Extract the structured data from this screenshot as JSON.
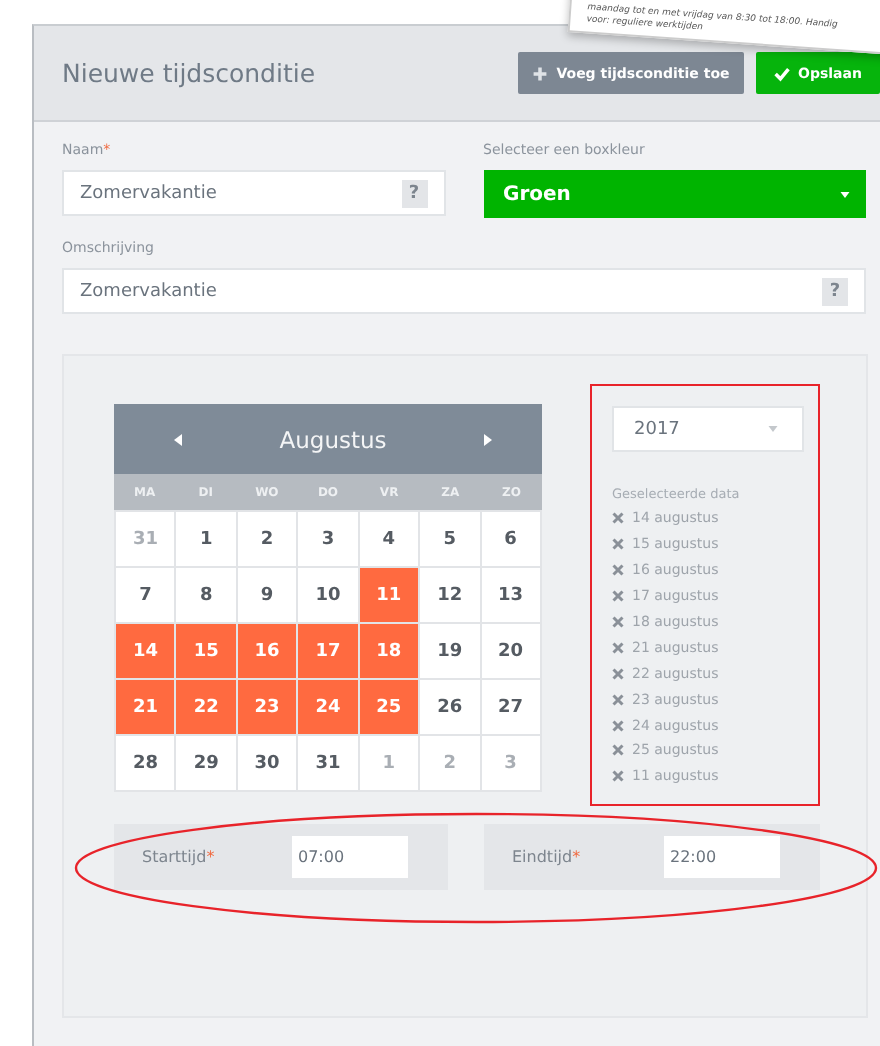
{
  "note": {
    "lines": [
      "maandag tot en met vrijdag van 8:30 tot 18:00. Handig",
      "voor: reguliere werktijden"
    ]
  },
  "header": {
    "title": "Nieuwe tijdsconditie",
    "buttons": [
      {
        "label": "Voeg tijdsconditie toe",
        "kind": "secondary"
      },
      {
        "label": "Opslaan",
        "kind": "primary"
      }
    ]
  },
  "form": {
    "name": {
      "label": "Naam",
      "required_mark": "*",
      "value": "Zomervakantie",
      "help": "?"
    },
    "box_color": {
      "label": "Selecteer een boxkleur",
      "value": "Groen",
      "color": "#00b400"
    },
    "description": {
      "label": "Omschrijving",
      "value": "Zomervakantie",
      "help": "?"
    }
  },
  "calendar": {
    "month": "Augustus",
    "weekdays": [
      "MA",
      "DI",
      "WO",
      "DO",
      "VR",
      "ZA",
      "ZO"
    ],
    "weeks": [
      [
        {
          "day": "31",
          "muted": true,
          "selected": false
        },
        {
          "day": "1",
          "muted": false,
          "selected": false
        },
        {
          "day": "2",
          "muted": false,
          "selected": false
        },
        {
          "day": "3",
          "muted": false,
          "selected": false
        },
        {
          "day": "4",
          "muted": false,
          "selected": false
        },
        {
          "day": "5",
          "muted": false,
          "selected": false
        },
        {
          "day": "6",
          "muted": false,
          "selected": false
        }
      ],
      [
        {
          "day": "7",
          "muted": false,
          "selected": false
        },
        {
          "day": "8",
          "muted": false,
          "selected": false
        },
        {
          "day": "9",
          "muted": false,
          "selected": false
        },
        {
          "day": "10",
          "muted": false,
          "selected": false
        },
        {
          "day": "11",
          "muted": false,
          "selected": true
        },
        {
          "day": "12",
          "muted": false,
          "selected": false
        },
        {
          "day": "13",
          "muted": false,
          "selected": false
        }
      ],
      [
        {
          "day": "14",
          "muted": false,
          "selected": true
        },
        {
          "day": "15",
          "muted": false,
          "selected": true
        },
        {
          "day": "16",
          "muted": false,
          "selected": true
        },
        {
          "day": "17",
          "muted": false,
          "selected": true
        },
        {
          "day": "18",
          "muted": false,
          "selected": true
        },
        {
          "day": "19",
          "muted": false,
          "selected": false
        },
        {
          "day": "20",
          "muted": false,
          "selected": false
        }
      ],
      [
        {
          "day": "21",
          "muted": false,
          "selected": true
        },
        {
          "day": "22",
          "muted": false,
          "selected": true
        },
        {
          "day": "23",
          "muted": false,
          "selected": true
        },
        {
          "day": "24",
          "muted": false,
          "selected": true
        },
        {
          "day": "25",
          "muted": false,
          "selected": true
        },
        {
          "day": "26",
          "muted": false,
          "selected": false
        },
        {
          "day": "27",
          "muted": false,
          "selected": false
        }
      ],
      [
        {
          "day": "28",
          "muted": false,
          "selected": false
        },
        {
          "day": "29",
          "muted": false,
          "selected": false
        },
        {
          "day": "30",
          "muted": false,
          "selected": false
        },
        {
          "day": "31",
          "muted": false,
          "selected": false
        },
        {
          "day": "1",
          "muted": true,
          "selected": false
        },
        {
          "day": "2",
          "muted": true,
          "selected": false
        },
        {
          "day": "3",
          "muted": true,
          "selected": false
        }
      ]
    ]
  },
  "year": "2017",
  "selected_dates": {
    "title": "Geselecteerde data",
    "items": [
      "14 augustus",
      "15 augustus",
      "16 augustus",
      "17 augustus",
      "18 augustus",
      "21 augustus",
      "22 augustus",
      "23 augustus",
      "24 augustus",
      "25 augustus",
      "11 augustus"
    ]
  },
  "times": [
    {
      "label": "Starttijd",
      "required_mark": "*",
      "value": "07:00"
    },
    {
      "label": "Eindtijd",
      "required_mark": "*",
      "value": "22:00"
    }
  ]
}
